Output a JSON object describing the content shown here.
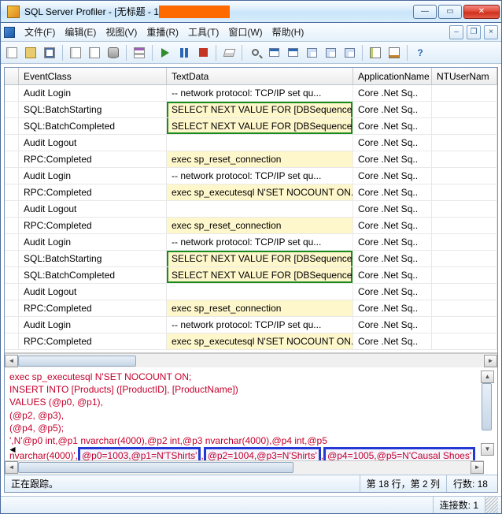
{
  "title": {
    "prefix": "SQL Server Profiler - [无标题 - 1"
  },
  "menu": {
    "file": "文件(F)",
    "edit": "编辑(E)",
    "view": "视图(V)",
    "replay": "重播(R)",
    "tools": "工具(T)",
    "window": "窗口(W)",
    "help": "帮助(H)"
  },
  "columns": {
    "event_class": "EventClass",
    "text_data": "TextData",
    "app_name": "ApplicationName",
    "nt_user": "NTUserNam"
  },
  "rows": [
    {
      "ec": "Audit Login",
      "td": "-- network protocol: TCP/IP  set qu...",
      "an": "Core .Net Sq.."
    },
    {
      "ec": "SQL:BatchStarting",
      "td": "SELECT NEXT VALUE FOR [DBSequenceHiLo]",
      "an": "Core .Net Sq..",
      "hl": true,
      "g": "top"
    },
    {
      "ec": "SQL:BatchCompleted",
      "td": "SELECT NEXT VALUE FOR [DBSequenceHiLo]",
      "an": "Core .Net Sq..",
      "hl": true,
      "g": "bot"
    },
    {
      "ec": "Audit Logout",
      "td": "",
      "an": "Core .Net Sq.."
    },
    {
      "ec": "RPC:Completed",
      "td": "exec sp_reset_connection",
      "an": "Core .Net Sq..",
      "hl": true
    },
    {
      "ec": "Audit Login",
      "td": "-- network protocol: TCP/IP  set qu...",
      "an": "Core .Net Sq.."
    },
    {
      "ec": "RPC:Completed",
      "td": "exec sp_executesql N'SET NOCOUNT ON...",
      "an": "Core .Net Sq..",
      "hl": true
    },
    {
      "ec": "Audit Logout",
      "td": "",
      "an": "Core .Net Sq.."
    },
    {
      "ec": "RPC:Completed",
      "td": "exec sp_reset_connection",
      "an": "Core .Net Sq..",
      "hl": true
    },
    {
      "ec": "Audit Login",
      "td": "-- network protocol: TCP/IP  set qu...",
      "an": "Core .Net Sq.."
    },
    {
      "ec": "SQL:BatchStarting",
      "td": "SELECT NEXT VALUE FOR [DBSequenceHiLo]",
      "an": "Core .Net Sq..",
      "hl": true,
      "g": "top"
    },
    {
      "ec": "SQL:BatchCompleted",
      "td": "SELECT NEXT VALUE FOR [DBSequenceHiLo]",
      "an": "Core .Net Sq..",
      "hl": true,
      "g": "bot"
    },
    {
      "ec": "Audit Logout",
      "td": "",
      "an": "Core .Net Sq.."
    },
    {
      "ec": "RPC:Completed",
      "td": "exec sp_reset_connection",
      "an": "Core .Net Sq..",
      "hl": true
    },
    {
      "ec": "Audit Login",
      "td": "-- network protocol: TCP/IP  set qu...",
      "an": "Core .Net Sq.."
    },
    {
      "ec": "RPC:Completed",
      "td": "exec sp_executesql N'SET NOCOUNT ON...",
      "an": "Core .Net Sq..",
      "hl": true
    }
  ],
  "detail": {
    "l0": "exec sp_executesql N'SET NOCOUNT ON;",
    "l1": "INSERT INTO [Products] ([ProductID], [ProductName])",
    "l2": "VALUES (@p0, @p1),",
    "l3": "(@p2, @p3),",
    "l4": "(@p4, @p5);",
    "l5a": "',N'@p0 int,@p1 nvarchar(4000),@p2 int,@p3 nvarchar(4000),@p4 int,@p5 ",
    "l5b_pre": "nvarchar(4000)',",
    "box1": "@p0=1003,@p1=N'TShirts'",
    "mid1": ",",
    "box2": "@p2=1004,@p3=N'Shirts'",
    "mid2": ",",
    "box3": "@p4=1005,@p5=N'Causal Shoes'",
    "scroll_marker": "◄"
  },
  "status": {
    "tracing": "正在跟踪。",
    "cursor": "第 18 行，第 2 列",
    "rows": "行数: 18",
    "conn": "连接数: 1"
  }
}
